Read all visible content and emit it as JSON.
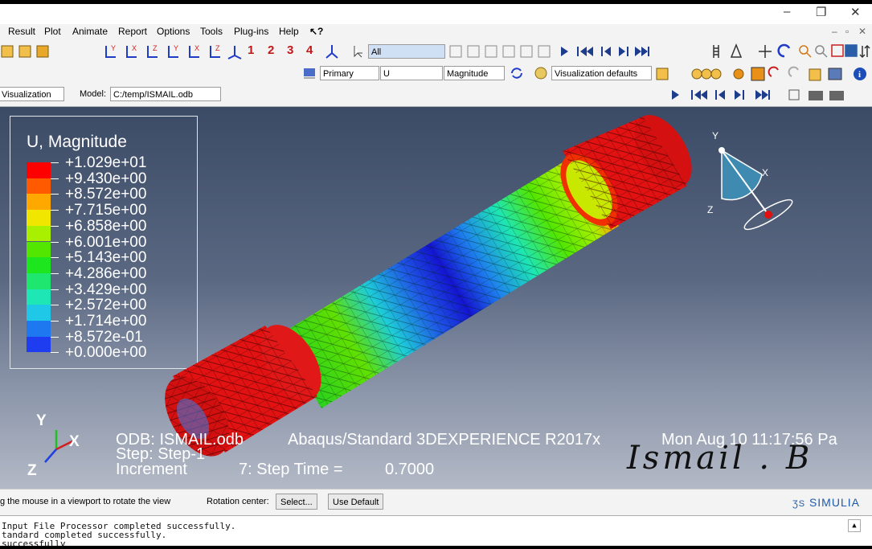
{
  "window": {
    "minimize": "–",
    "restore": "❐",
    "close": "✕"
  },
  "menu": [
    "Result",
    "Plot",
    "Animate",
    "Report",
    "Options",
    "Tools",
    "Plug-ins",
    "Help",
    "↖?"
  ],
  "toolbar1": {
    "numbers": [
      "1",
      "2",
      "3",
      "4"
    ],
    "filter_value": "All"
  },
  "toolbar2": {
    "primary": "Primary",
    "variable": "U",
    "invariant": "Magnitude",
    "visualization_defaults": "Visualization defaults"
  },
  "toolbar3": {
    "module": "Visualization",
    "model_label": "Model:",
    "model_value": "C:/temp/ISMAIL.odb"
  },
  "legend": {
    "title": "U, Magnitude",
    "values": [
      "+1.029e+01",
      "+9.430e+00",
      "+8.572e+00",
      "+7.715e+00",
      "+6.858e+00",
      "+6.001e+00",
      "+5.143e+00",
      "+4.286e+00",
      "+3.429e+00",
      "+2.572e+00",
      "+1.714e+00",
      "+8.572e-01",
      "+0.000e+00"
    ],
    "colors": [
      "#ff0000",
      "#ff5a00",
      "#ffa800",
      "#f0e600",
      "#a8f000",
      "#52e600",
      "#1ee61e",
      "#1ee66e",
      "#1ee6b4",
      "#1ec8e6",
      "#1e78f0",
      "#1e3cf0",
      "#1414d2"
    ]
  },
  "triad": {
    "y": "Y",
    "x": "X",
    "z": "Z"
  },
  "info": {
    "odb": "ODB: ISMAIL.odb",
    "solver": "Abaqus/Standard 3DEXPERIENCE R2017x",
    "date": "Mon Aug 10 11:17:56 Pa",
    "step": "Step: Step-1",
    "increment": "Increment",
    "step_time": "7: Step Time =",
    "step_time_value": "0.7000"
  },
  "signature": "Ismail . B",
  "status": {
    "prompt": "g the mouse in a viewport to rotate the view",
    "rotation_center": "Rotation center:",
    "select": "Select...",
    "use_default": "Use Default",
    "brand": "SIMULIA"
  },
  "messages": [
    "Input File Processor completed successfully.",
    "tandard completed successfully.",
    "successfully"
  ]
}
